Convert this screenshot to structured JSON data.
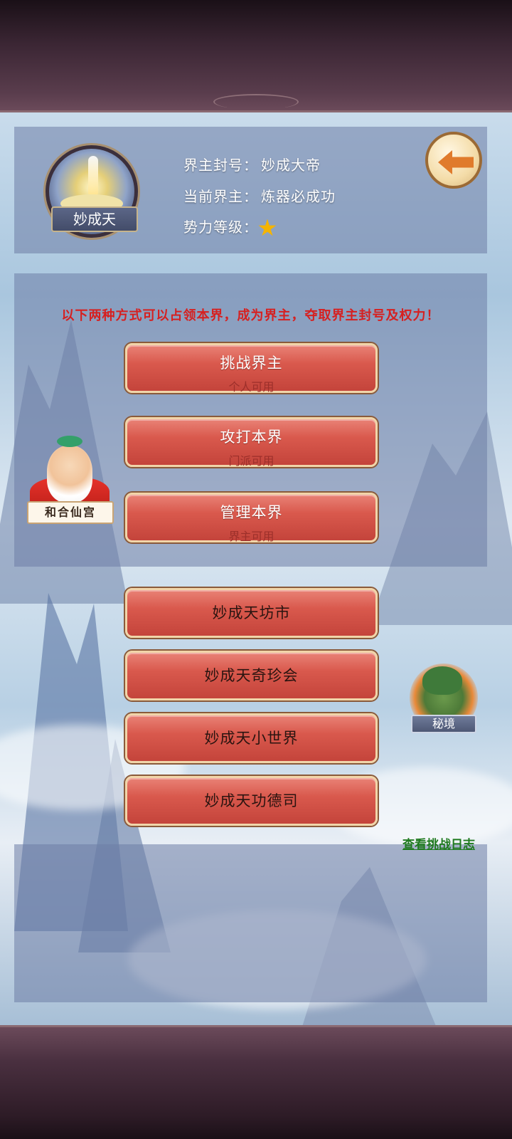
{
  "header": {
    "realm_name": "妙成天",
    "title_label": "界主封号：",
    "title_value": "妙成大帝",
    "lord_label": "当前界主：",
    "lord_value": "炼器必成功",
    "level_label": "势力等级：",
    "level_stars": 1
  },
  "notice": "以下两种方式可以占领本界，成为界主，夺取界主封号及权力！",
  "primary_actions": [
    {
      "label": "挑战界主",
      "sub": "个人可用"
    },
    {
      "label": "攻打本界",
      "sub": "门派可用"
    },
    {
      "label": "管理本界",
      "sub": "界主可用"
    }
  ],
  "npc": {
    "label": "和合仙宫"
  },
  "secondary_actions": [
    {
      "label": "妙成天坊市"
    },
    {
      "label": "妙成天奇珍会"
    },
    {
      "label": "妙成天小世界"
    },
    {
      "label": "妙成天功德司"
    }
  ],
  "secret_realm": {
    "label": "秘境"
  },
  "log_link": "查看挑战日志",
  "colors": {
    "notice": "#d62020",
    "button": "#d9594d",
    "log_link": "#1f7a1f",
    "star": "#f5b400"
  },
  "icons": {
    "back": "back-arrow-icon",
    "level": "star-icon"
  }
}
